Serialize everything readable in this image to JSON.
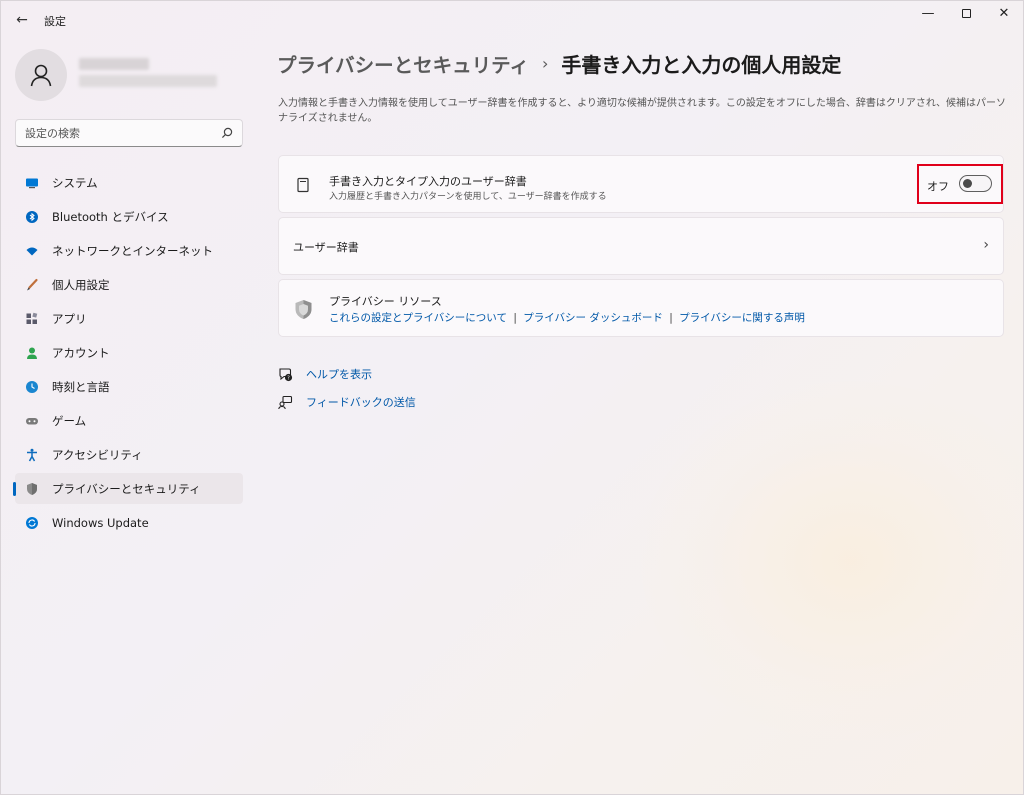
{
  "window": {
    "app_title": "設定",
    "back_glyph": "←",
    "minimize_glyph": "—",
    "close_glyph": "✕"
  },
  "profile": {
    "avatar_icon": "person-icon"
  },
  "search": {
    "placeholder": "設定の検索"
  },
  "sidebar": {
    "items": [
      {
        "label": "システム",
        "icon": "system-icon",
        "color": "#0078d4"
      },
      {
        "label": "Bluetooth とデバイス",
        "icon": "bluetooth-icon",
        "color": "#0067c0"
      },
      {
        "label": "ネットワークとインターネット",
        "icon": "wifi-icon",
        "color": "#0067c0"
      },
      {
        "label": "個人用設定",
        "icon": "brush-icon",
        "color": "#c0703c"
      },
      {
        "label": "アプリ",
        "icon": "apps-icon",
        "color": "#5a5a6a"
      },
      {
        "label": "アカウント",
        "icon": "account-icon",
        "color": "#2ea44f"
      },
      {
        "label": "時刻と言語",
        "icon": "time-language-icon",
        "color": "#1a86d0"
      },
      {
        "label": "ゲーム",
        "icon": "gaming-icon",
        "color": "#6b6b6b"
      },
      {
        "label": "アクセシビリティ",
        "icon": "accessibility-icon",
        "color": "#0f6cbd"
      },
      {
        "label": "プライバシーとセキュリティ",
        "icon": "shield-icon",
        "color": "#6f6f6f",
        "active": true
      },
      {
        "label": "Windows Update",
        "icon": "windows-update-icon",
        "color": "#0078d4"
      }
    ]
  },
  "main": {
    "breadcrumb_parent": "プライバシーとセキュリティ",
    "breadcrumb_separator": "›",
    "page_title": "手書き入力と入力の個人用設定",
    "description": "入力情報と手書き入力情報を使用してユーザー辞書を作成すると、より適切な候補が提供されます。この設定をオフにした場合、辞書はクリアされ、候補はパーソナライズされません。",
    "dictionary_card": {
      "title": "手書き入力とタイプ入力のユーザー辞書",
      "subtitle": "入力履歴と手書き入力パターンを使用して、ユーザー辞書を作成する",
      "toggle_label": "オフ",
      "toggle_on": false
    },
    "user_dictionary_card": {
      "title": "ユーザー辞書",
      "chevron": "›"
    },
    "privacy_resources": {
      "title": "プライバシー リソース",
      "links": [
        "これらの設定とプライバシーについて",
        "プライバシー ダッシュボード",
        "プライバシーに関する声明"
      ],
      "separator": "|"
    },
    "help_links": {
      "help": "ヘルプを表示",
      "feedback": "フィードバックの送信"
    }
  },
  "colors": {
    "accent": "#0067c0",
    "highlight_border": "#e0001a"
  }
}
